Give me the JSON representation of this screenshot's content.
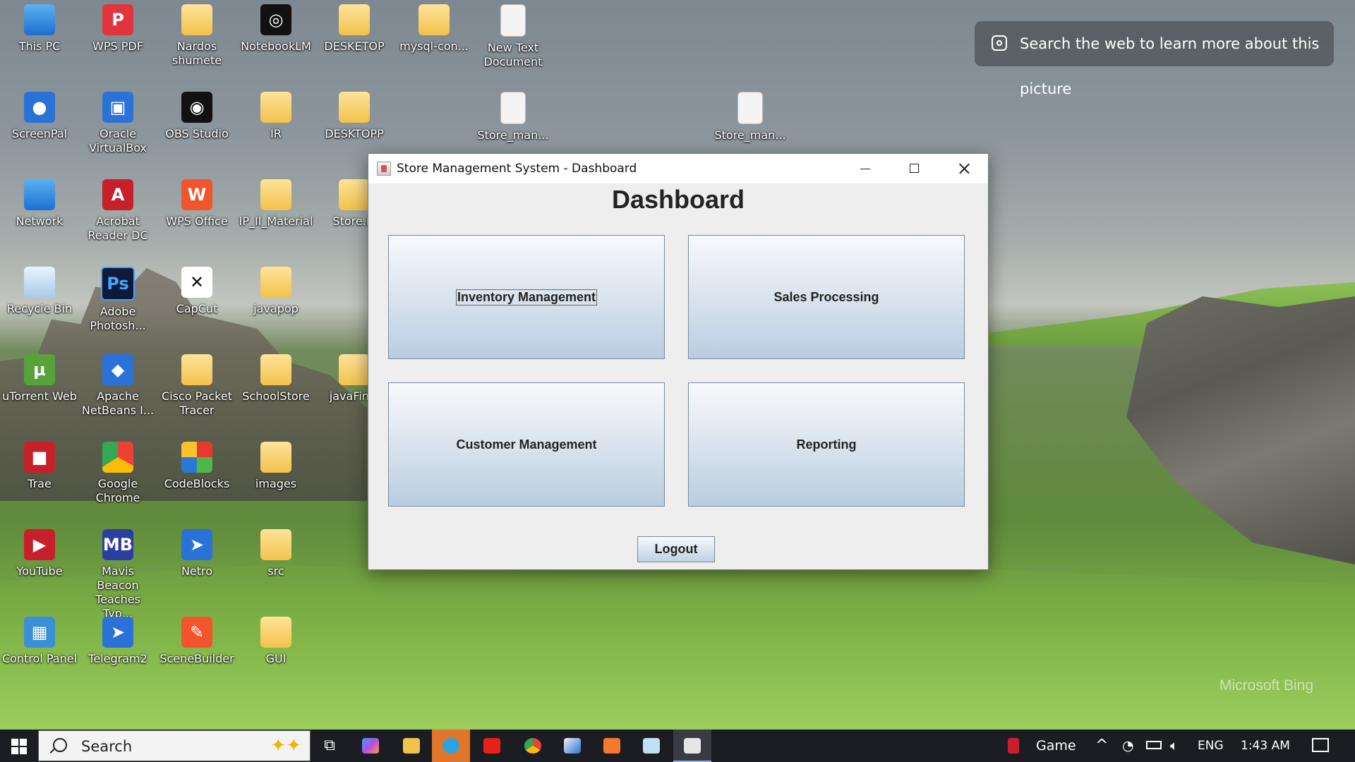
{
  "desktop": {
    "icons": [
      {
        "label": "This PC"
      },
      {
        "label": "WPS PDF"
      },
      {
        "label": "Nardos shumete"
      },
      {
        "label": "NotebookLM"
      },
      {
        "label": "DESKETOP"
      },
      {
        "label": "mysql-con..."
      },
      {
        "label": "New Text Document"
      },
      {
        "label": "ScreenPal"
      },
      {
        "label": "Oracle VirtualBox"
      },
      {
        "label": "OBS Studio"
      },
      {
        "label": "IR"
      },
      {
        "label": "DESKTOPP"
      },
      {
        "label": "Store_man..."
      },
      {
        "label": "Store_man..."
      },
      {
        "label": "Network"
      },
      {
        "label": "Acrobat Reader DC"
      },
      {
        "label": "WPS Office"
      },
      {
        "label": "IP_II_Material"
      },
      {
        "label": "Store.M"
      },
      {
        "label": "Recycle Bin"
      },
      {
        "label": "Adobe Photosh..."
      },
      {
        "label": "CapCut"
      },
      {
        "label": "javapop"
      },
      {
        "label": "uTorrent Web"
      },
      {
        "label": "Apache NetBeans I..."
      },
      {
        "label": "Cisco Packet Tracer"
      },
      {
        "label": "SchoolStore"
      },
      {
        "label": "javaFinal"
      },
      {
        "label": "Trae"
      },
      {
        "label": "Google Chrome"
      },
      {
        "label": "CodeBlocks"
      },
      {
        "label": "images"
      },
      {
        "label": "YouTube"
      },
      {
        "label": "Mavis Beacon Teaches Typ..."
      },
      {
        "label": "Netro"
      },
      {
        "label": "src"
      },
      {
        "label": "Control Panel"
      },
      {
        "label": "Telegram2"
      },
      {
        "label": "SceneBuilder"
      },
      {
        "label": "GUI"
      }
    ],
    "search_pill": "Search the web to learn more about this picture",
    "watermark": "Microsoft Bing"
  },
  "window": {
    "title": "Store Management System - Dashboard",
    "heading": "Dashboard",
    "buttons": {
      "inventory": "Inventory Management",
      "sales": "Sales Processing",
      "customer": "Customer Management",
      "reporting": "Reporting"
    },
    "logout": "Logout"
  },
  "taskbar": {
    "search_placeholder": "Search",
    "tray": {
      "game": "Game",
      "language": "ENG",
      "time": "1:43 AM"
    }
  }
}
